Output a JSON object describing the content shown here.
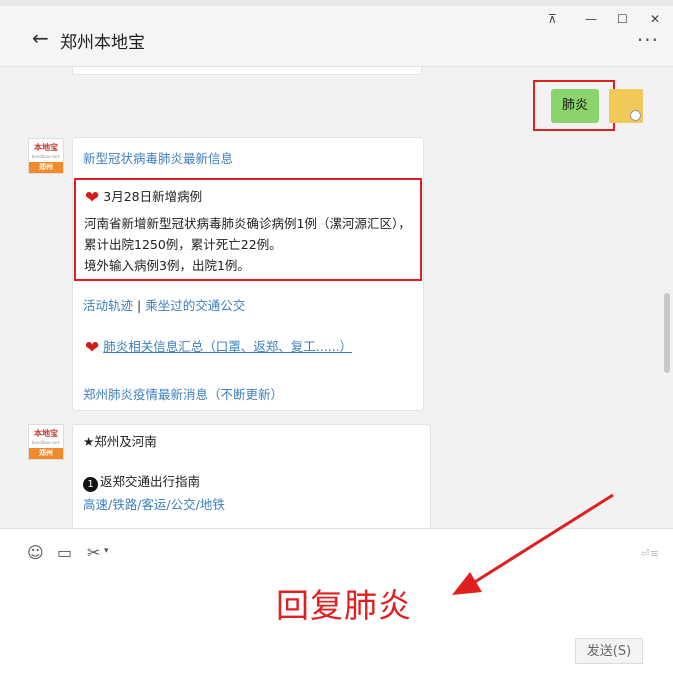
{
  "window": {
    "pin_icon": "pin-icon",
    "minimize_label": "—",
    "maximize_label": "☐",
    "close_label": "✕"
  },
  "header": {
    "back_icon": "←",
    "title": "郑州本地宝",
    "more_icon": "···"
  },
  "chat": {
    "my_message": "肺炎",
    "bot_avatar": {
      "logo_top": "本地宝",
      "logo_mid": "bendibao.com",
      "logo_city": "郑州"
    },
    "card1": {
      "headline_link": "新型冠状病毒肺炎最新信息",
      "heart_icon": "❤",
      "update_title": "3月28日新增病例",
      "update_body_1": "河南省新增新型冠状病毒肺炎确诊病例1例（漯河源汇区），累计出院1250例，累计死亡22例。",
      "update_body_2": "境外输入病例3例，出院1例。",
      "link_track": "活动轨迹",
      "separator": "|",
      "link_transit": "乘坐过的交通公交",
      "link_info": "肺炎相关信息汇总（口罩、返郑、复工......）",
      "link_latest": "郑州肺炎疫情最新消息（不断更新）"
    },
    "card2": {
      "heading": "★郑州及河南",
      "item_number": "1",
      "item_title": "返郑交通出行指南",
      "item_links": "高速/铁路/客运/公交/地铁"
    }
  },
  "input": {
    "emoji_icon": "☺",
    "folder_icon": "▭",
    "scissors_icon": "✂",
    "send_hint": "⏎≡",
    "annotation": "回复肺炎",
    "send_button": "发送(S)"
  },
  "colors": {
    "annotation_red": "#e02020",
    "link_blue": "#3d7fc1",
    "bubble_green": "#8bd36b",
    "brand_orange": "#f08a2a"
  }
}
